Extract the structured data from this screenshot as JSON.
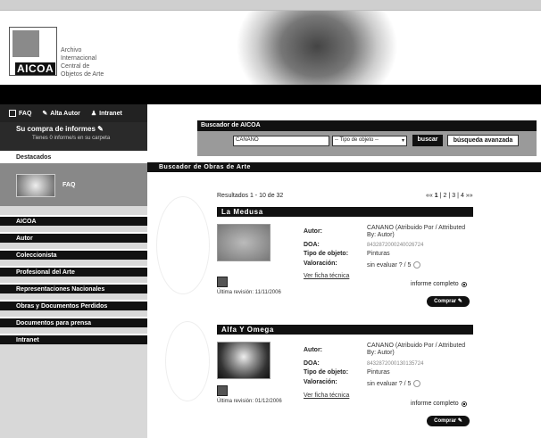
{
  "brand": {
    "logo": "AICOA",
    "subtitle_lines": [
      "Archivo",
      "Internacional",
      "Central de",
      "Objetos de Arte"
    ]
  },
  "toplinks": [
    {
      "label": "FAQ",
      "icon": "doc-icon"
    },
    {
      "label": "Alta Autor",
      "icon": "feather-icon"
    },
    {
      "label": "Intranet",
      "icon": "person-icon"
    }
  ],
  "cart": {
    "title": "Su compra de informes",
    "status": "Tienes 0 informe/s en su carpeta"
  },
  "featured": {
    "title": "Destacados",
    "label": "FAQ"
  },
  "nav": [
    "AICOA",
    "Autor",
    "Coleccionista",
    "Profesional del Arte",
    "Representaciones Nacionales",
    "Obras y Documentos Perdidos",
    "Documentos para prensa",
    "Intranet"
  ],
  "search": {
    "title": "Buscador de AICOA",
    "query": "CANANO",
    "type_select": "-- Tipo de objeto --",
    "buscar": "buscar",
    "advanced": "búsqueda avanzada"
  },
  "section_title": "Buscador de Obras de Arte",
  "results_summary": "Resultados 1 - 10 de 32",
  "pager": {
    "prev": "««",
    "pages": [
      "1",
      "2",
      "3",
      "4"
    ],
    "next": "»»"
  },
  "labels": {
    "autor": "Autor:",
    "doa": "DOA:",
    "tipo": "Tipo de objeto:",
    "valoracion": "Valoración:",
    "ficha": "Ver ficha técnica",
    "complete": "informe completo",
    "buy": "Comprar"
  },
  "results": [
    {
      "title": "La Medusa",
      "autor": "CANANO (Atribuido Por / Attributed By: Autor)",
      "doa": "8432872000240026724⁠",
      "tipo": "Pinturas",
      "valoracion": "sin evaluar  ? / 5",
      "revision": "Última revisión: 11/11/2006"
    },
    {
      "title": "Alfa Y Omega",
      "autor": "CANANO (Atribuido Por / Attributed By: Autor)",
      "doa": "8432872000130135724⁠",
      "tipo": "Pinturas",
      "valoracion": "sin evaluar  ? / 5",
      "revision": "Última revisión: 01/12/2006"
    }
  ]
}
